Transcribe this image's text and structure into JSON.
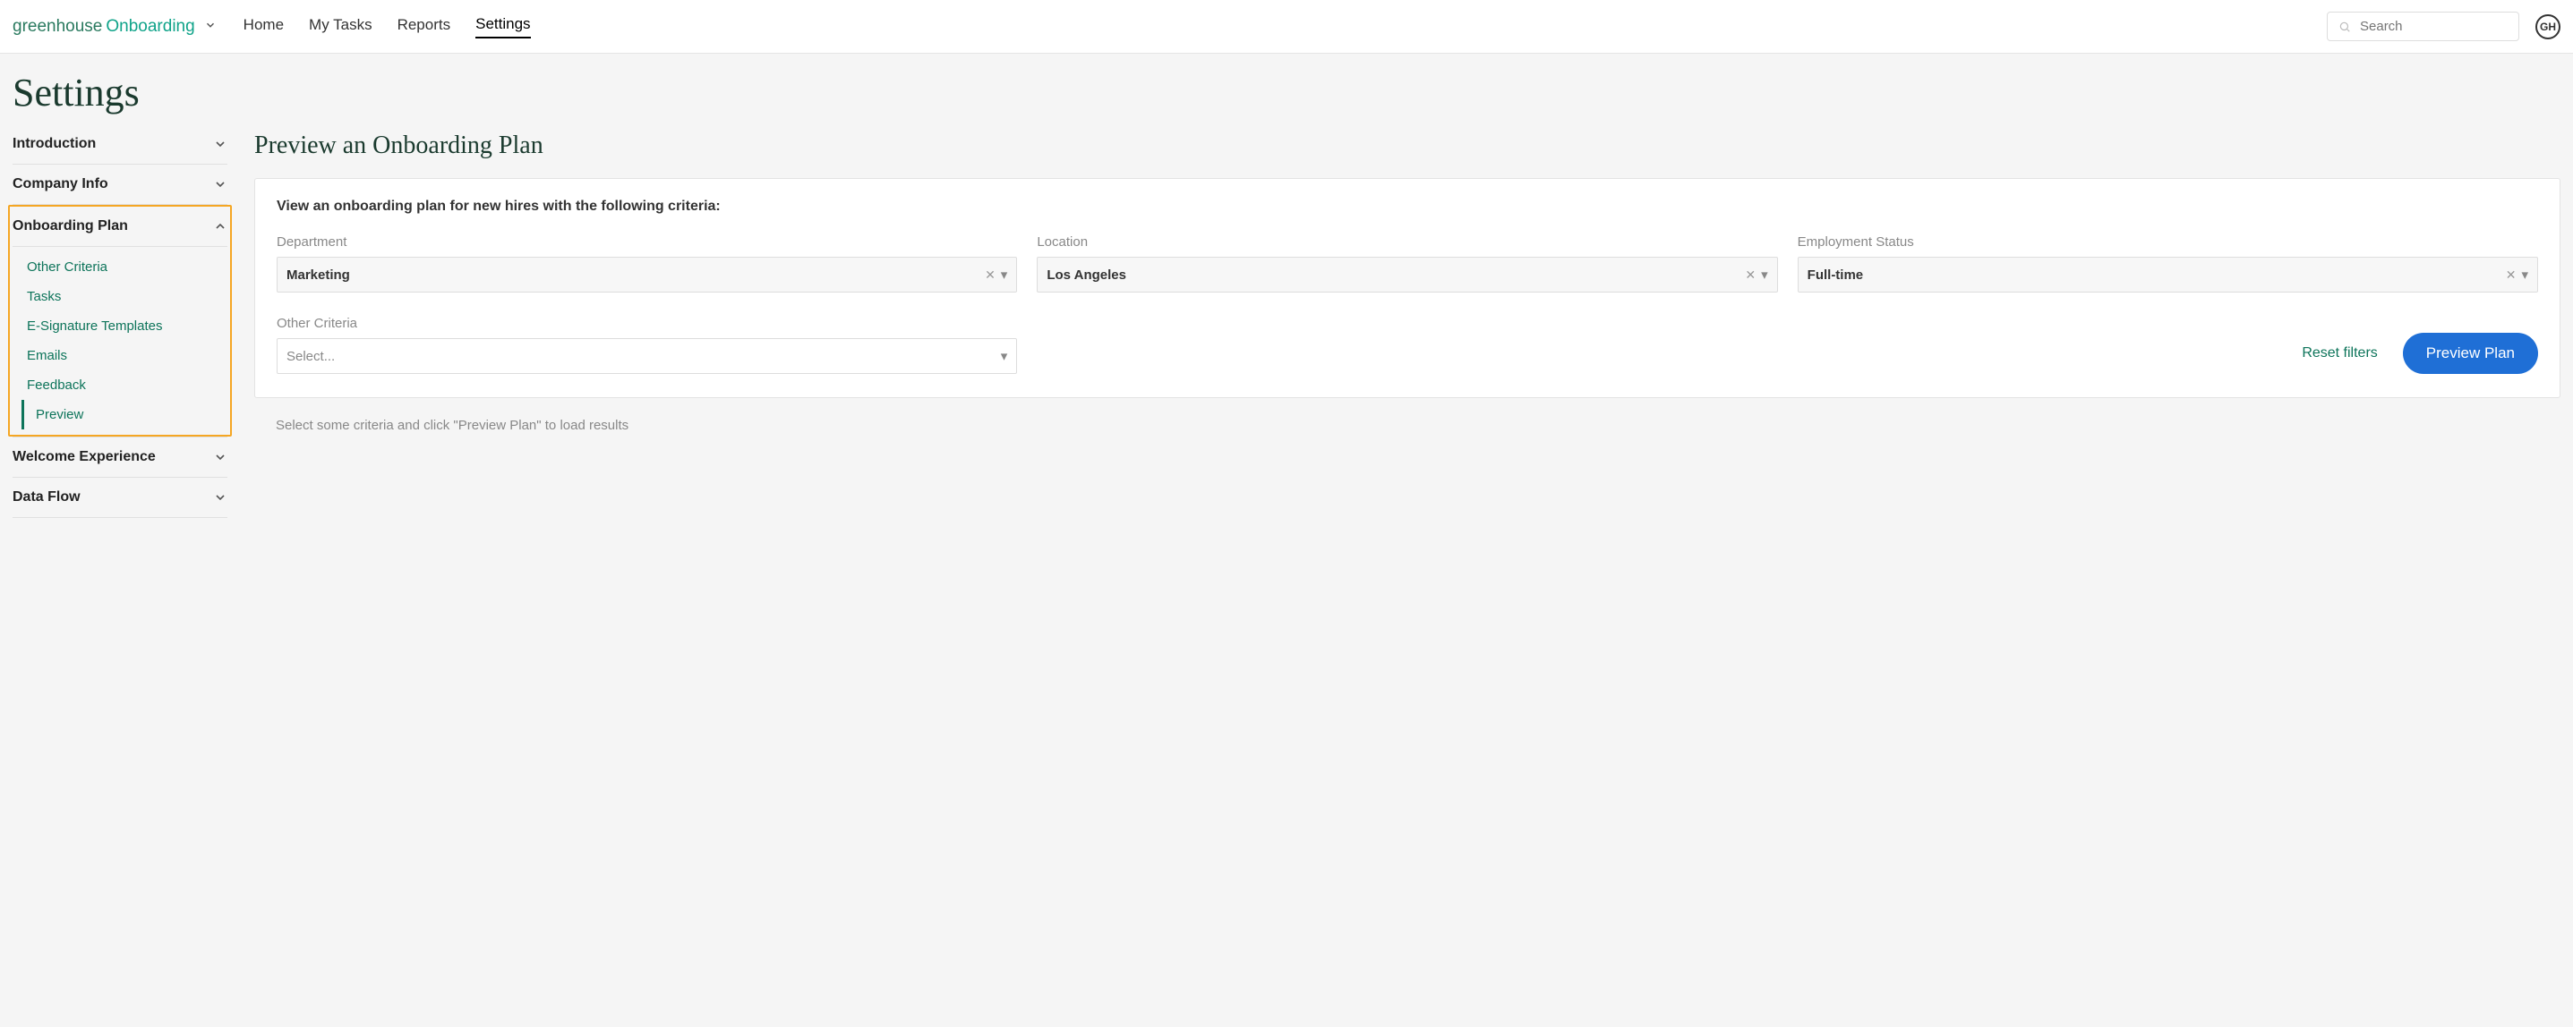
{
  "nav": {
    "logo_main": "greenhouse",
    "logo_sub": "Onboarding",
    "links": [
      "Home",
      "My Tasks",
      "Reports",
      "Settings"
    ],
    "active_index": 3,
    "search_placeholder": "Search",
    "avatar_initials": "GH"
  },
  "page": {
    "title": "Settings"
  },
  "sidebar": {
    "sections": [
      {
        "label": "Introduction",
        "expanded": false
      },
      {
        "label": "Company Info",
        "expanded": false
      },
      {
        "label": "Onboarding Plan",
        "expanded": true,
        "highlighted": true,
        "items": [
          "Other Criteria",
          "Tasks",
          "E-Signature Templates",
          "Emails",
          "Feedback",
          "Preview"
        ],
        "active_item_index": 5
      },
      {
        "label": "Welcome Experience",
        "expanded": false
      },
      {
        "label": "Data Flow",
        "expanded": false
      }
    ]
  },
  "main": {
    "title": "Preview an Onboarding Plan",
    "card_heading": "View an onboarding plan for new hires with the following criteria:",
    "filters": {
      "department": {
        "label": "Department",
        "value": "Marketing"
      },
      "location": {
        "label": "Location",
        "value": "Los Angeles"
      },
      "employment_status": {
        "label": "Employment Status",
        "value": "Full-time"
      },
      "other": {
        "label": "Other Criteria",
        "placeholder": "Select..."
      }
    },
    "reset_label": "Reset filters",
    "preview_button": "Preview Plan",
    "hint": "Select some criteria and click \"Preview Plan\" to load results"
  }
}
